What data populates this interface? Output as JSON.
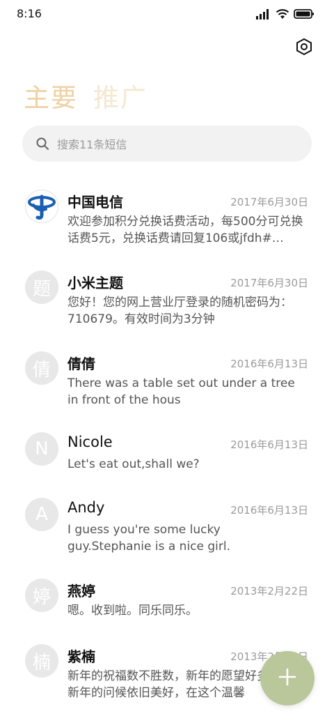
{
  "status_bar": {
    "time": "8:16"
  },
  "tabs": [
    {
      "label": "主要",
      "active": true
    },
    {
      "label": "推广",
      "active": false
    }
  ],
  "search": {
    "placeholder": "搜索11条短信"
  },
  "messages": [
    {
      "sender": "中国电信",
      "date": "2017年6月30日",
      "preview": "欢迎参加积分兑换话费活动，每500分可兑换话费5元，兑换话费请回复106或jfdh#…",
      "avatar_icon": "china-telecom-logo"
    },
    {
      "sender": "小米主题",
      "date": "2017年6月30日",
      "preview": "您好！您的网上营业厅登录的随机密码为：710679。有效时间为3分钟",
      "avatar_text": "题"
    },
    {
      "sender": "倩倩",
      "date": "2016年6月13日",
      "preview": "There was a table set out under a tree in front of the hous",
      "avatar_text": "倩"
    },
    {
      "sender": "Nicole",
      "date": "2016年6月13日",
      "preview": "Let's eat out,shall we?",
      "avatar_text": "N"
    },
    {
      "sender": "Andy",
      "date": "2016年6月13日",
      "preview": "I guess you're some lucky guy.Stephanie is a nice girl.",
      "avatar_text": "A"
    },
    {
      "sender": "燕婷",
      "date": "2013年2月22日",
      "preview": "嗯。收到啦。同乐同乐。",
      "avatar_text": "婷"
    },
    {
      "sender": "紫楠",
      "date": "2013年2月22日",
      "preview": "新年的祝福数不胜数，新年的愿望好多好多，新年的问候依旧美好，在这个温馨",
      "avatar_text": "楠"
    }
  ],
  "colors": {
    "tab_active": "#eed2a3",
    "tab_inactive": "#f4e8d2",
    "fab": "#b9c79a",
    "search_bg": "#f2f2f2",
    "avatar_bg": "#e8e8e8"
  }
}
